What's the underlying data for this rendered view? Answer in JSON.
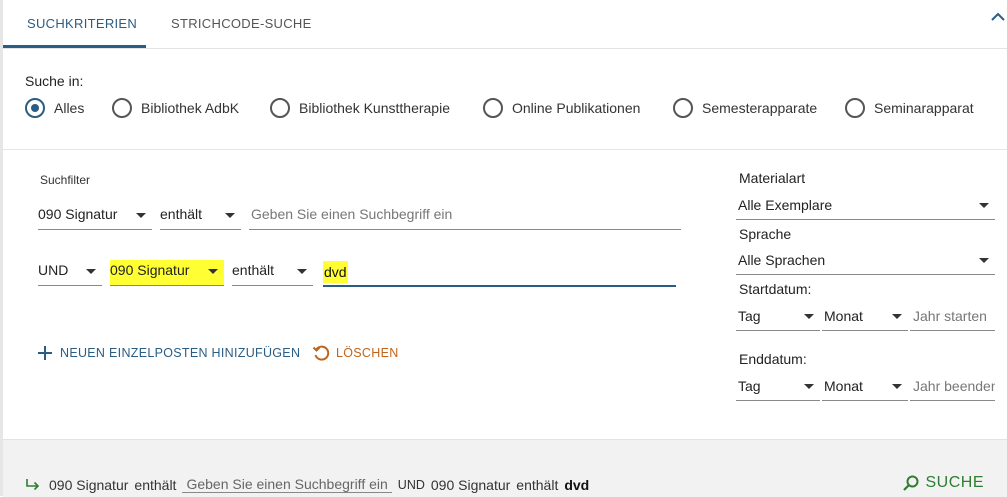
{
  "tabs": [
    {
      "label": "SUCHKRITERIEN",
      "active": true
    },
    {
      "label": "STRICHCODE-SUCHE",
      "active": false
    }
  ],
  "search_in": {
    "label": "Suche in:",
    "options": [
      "Alles",
      "Bibliothek AdbK",
      "Bibliothek Kunsttherapie",
      "Online Publikationen",
      "Semesterapparate",
      "Seminarapparat"
    ],
    "selected": "Alles"
  },
  "filter": {
    "label": "Suchfilter",
    "row1": {
      "field": "090 Signatur",
      "operator": "enthält",
      "placeholder": "Geben Sie einen Suchbegriff ein"
    },
    "row2": {
      "connector": "UND",
      "field": "090 Signatur",
      "operator": "enthält",
      "value": "dvd"
    },
    "add_label": "NEUEN EINZELPOSTEN HINIZUFÜGEN",
    "clear_label": "LÖSCHEN"
  },
  "side": {
    "materialart_label": "Materialart",
    "materialart_value": "Alle Exemplare",
    "sprache_label": "Sprache",
    "sprache_value": "Alle Sprachen",
    "startdatum_label": "Startdatum:",
    "enddatum_label": "Enddatum:",
    "tag": "Tag",
    "monat": "Monat",
    "jahr_start_placeholder": "Jahr starten",
    "jahr_end_placeholder": "Jahr beenden"
  },
  "summary": {
    "field1": "090 Signatur",
    "op1": "enthält",
    "placeholder1": "Geben Sie einen Suchbegriff ein",
    "connector": "UND",
    "field2": "090 Signatur",
    "op2": "enthält",
    "value2": "dvd"
  },
  "search_button_label": "SUCHE",
  "colors": {
    "accent": "#2a5d84",
    "delete": "#c0651c",
    "search": "#2e7d32",
    "highlight": "#ffff33"
  }
}
